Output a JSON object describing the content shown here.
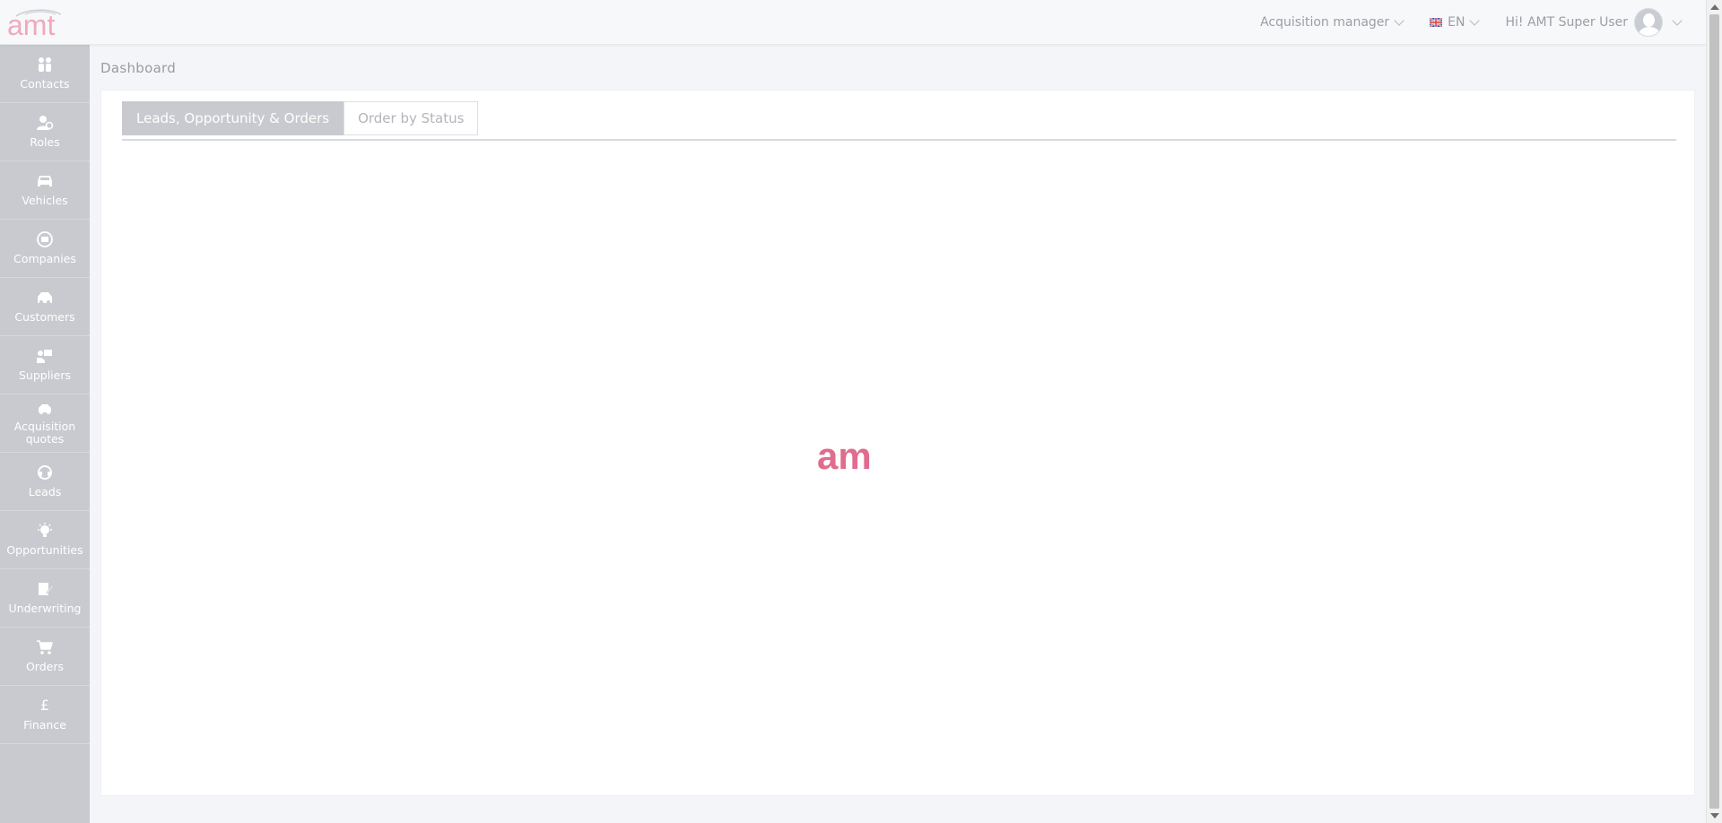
{
  "header": {
    "role_selector": "Acquisition manager",
    "language": "EN",
    "greeting": "Hi! AMT Super User"
  },
  "brand": {
    "logo_text": "amt",
    "loader_text": "am",
    "accent_color": "#e06c8e",
    "accent_light": "#f3b7c7"
  },
  "sidebar": {
    "items": [
      {
        "label": "Contacts",
        "icon": "contacts-icon"
      },
      {
        "label": "Roles",
        "icon": "roles-icon"
      },
      {
        "label": "Vehicles",
        "icon": "vehicle-icon"
      },
      {
        "label": "Companies",
        "icon": "companies-icon"
      },
      {
        "label": "Customers",
        "icon": "customers-icon"
      },
      {
        "label": "Suppliers",
        "icon": "suppliers-icon"
      },
      {
        "label": "Acquisition quotes",
        "icon": "acquisition-quotes-icon"
      },
      {
        "label": "Leads",
        "icon": "leads-icon"
      },
      {
        "label": "Opportunities",
        "icon": "opportunities-icon"
      },
      {
        "label": "Underwriting",
        "icon": "underwriting-icon"
      },
      {
        "label": "Orders",
        "icon": "orders-icon"
      },
      {
        "label": "Finance",
        "icon": "pound-icon"
      }
    ]
  },
  "main": {
    "title": "Dashboard",
    "tabs": [
      {
        "label": "Leads, Opportunity & Orders",
        "active": true
      },
      {
        "label": "Order by Status",
        "active": false
      }
    ]
  }
}
